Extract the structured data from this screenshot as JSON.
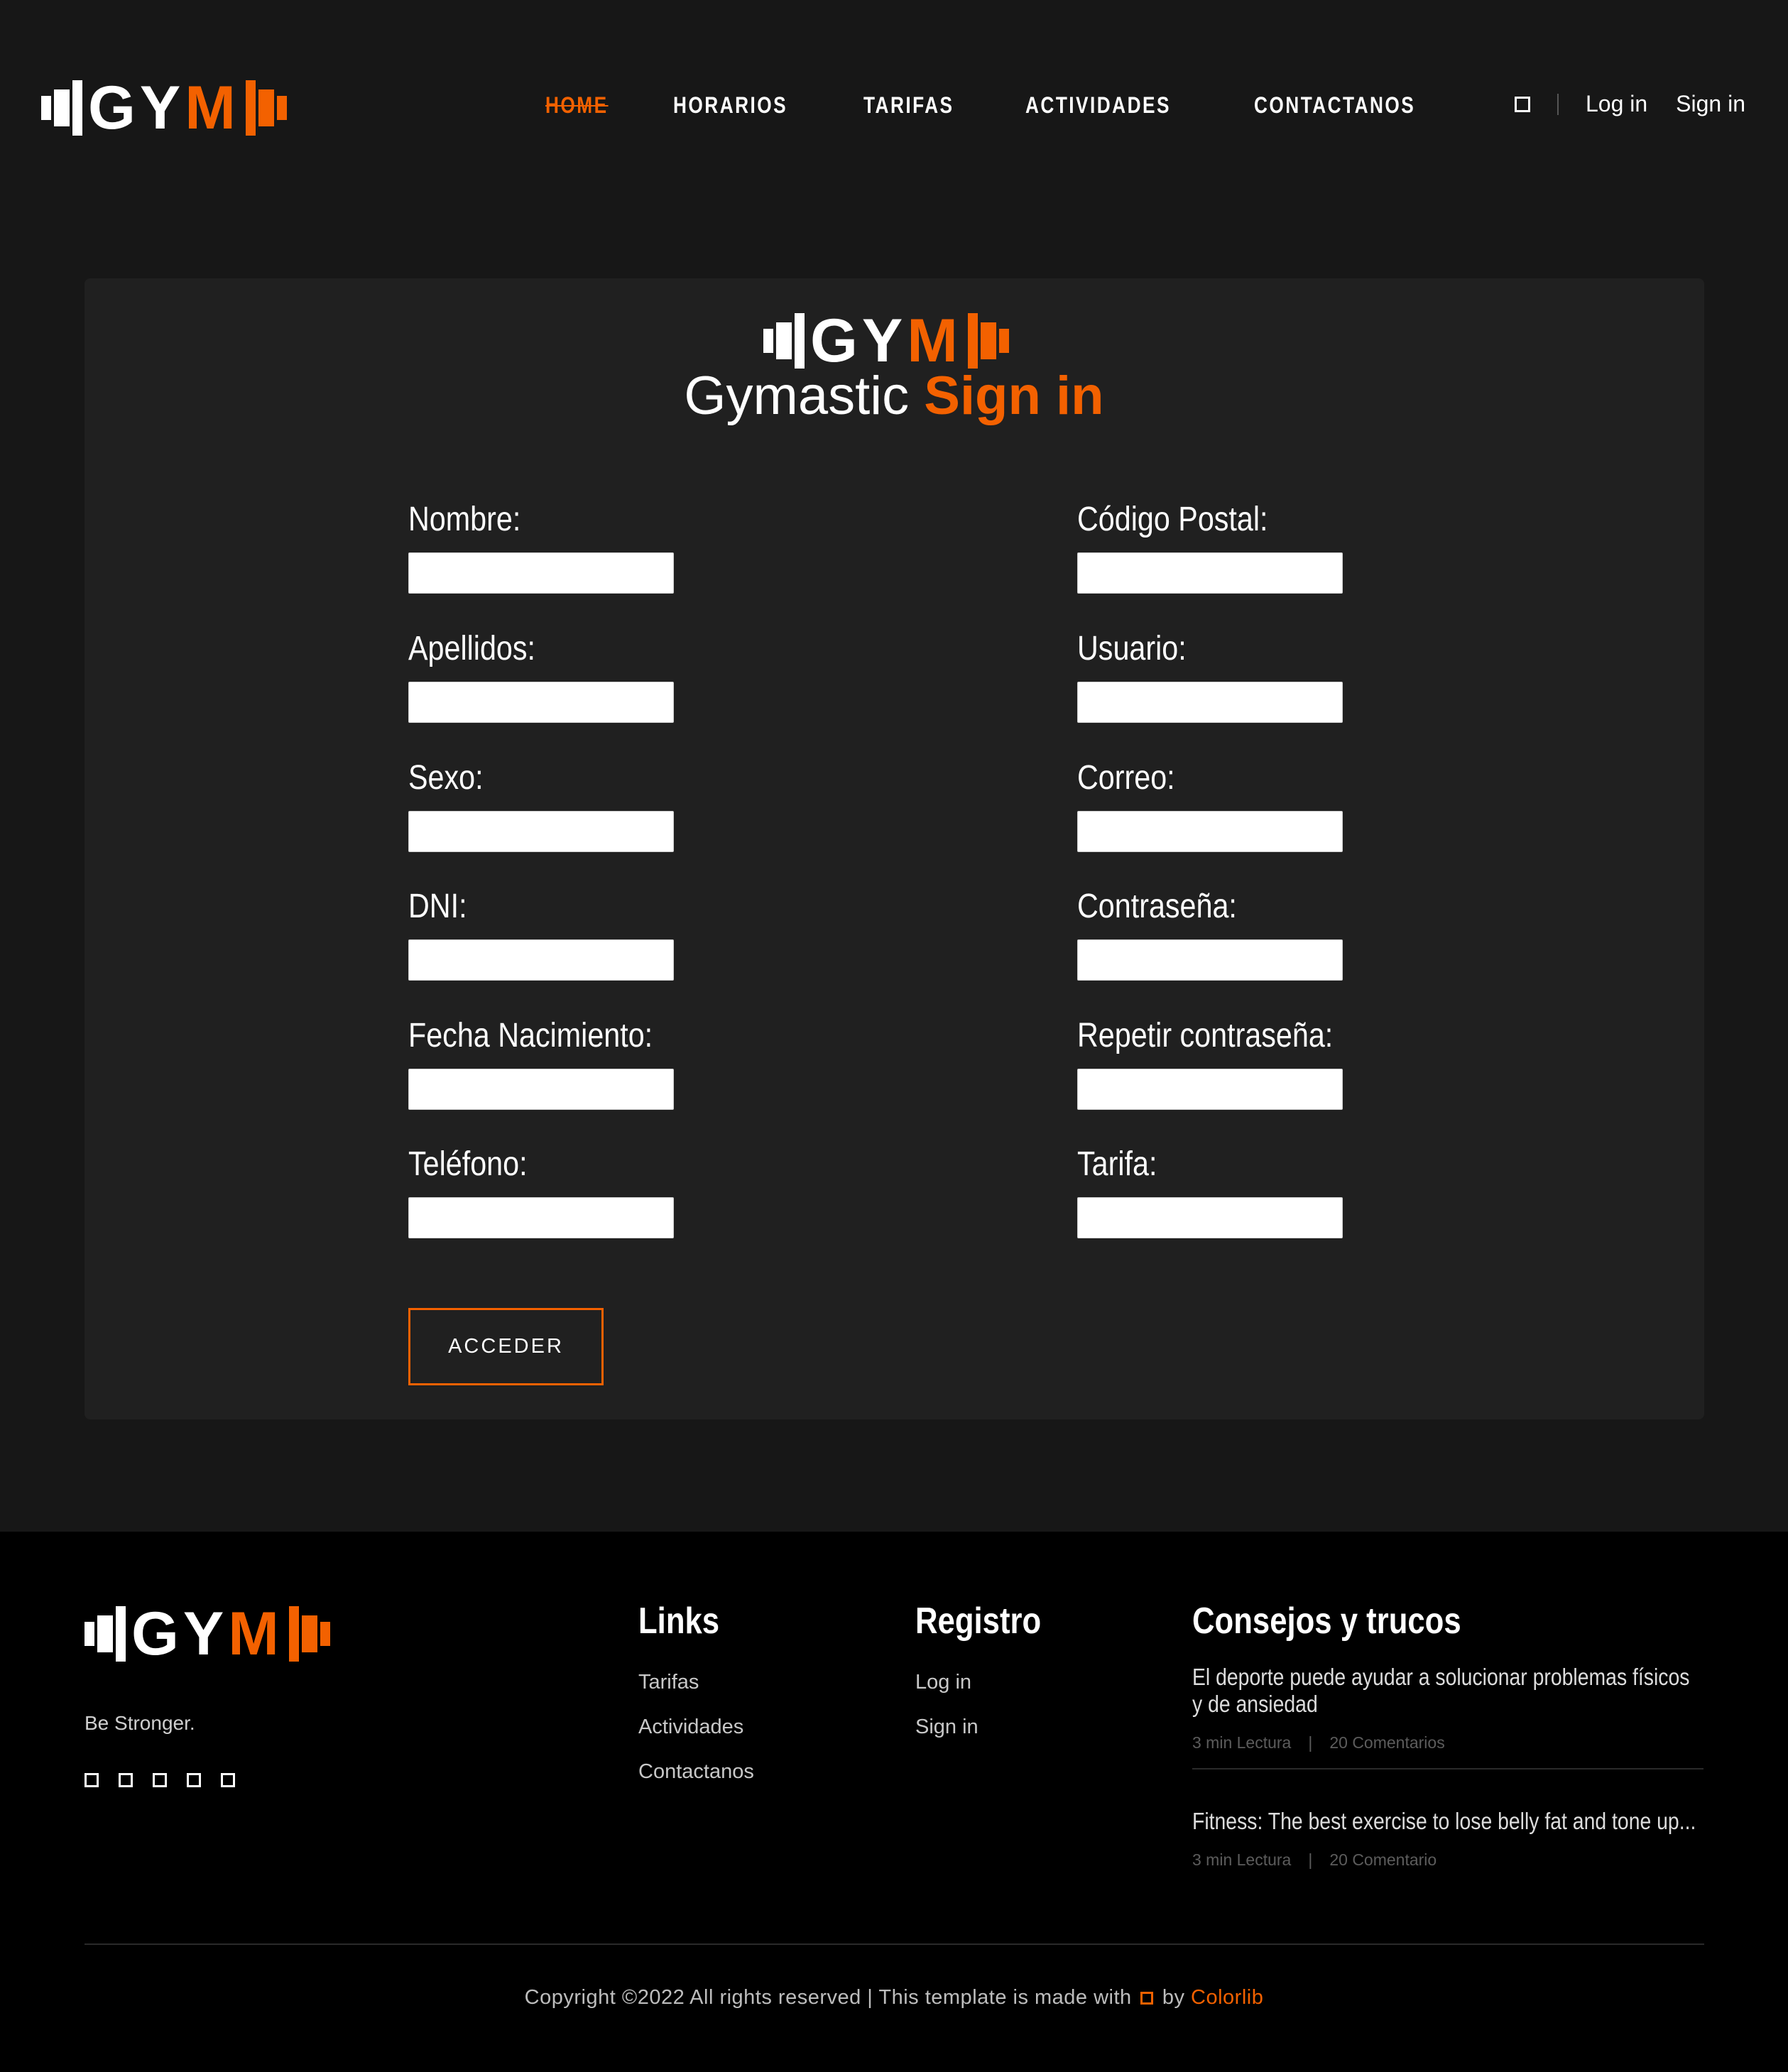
{
  "brand": {
    "logo_left": "GY",
    "logo_right": "M",
    "accent_color": "#f36100"
  },
  "nav": {
    "items": [
      {
        "label": "HOME",
        "active": true
      },
      {
        "label": "HORARIOS",
        "active": false
      },
      {
        "label": "TARIFAS",
        "active": false
      },
      {
        "label": "ACTIVIDADES",
        "active": false
      },
      {
        "label": "CONTACTANOS",
        "active": false
      }
    ],
    "search_icon": "square-icon",
    "login_label": "Log in",
    "signin_label": "Sign in"
  },
  "form": {
    "title_plain": "Gymastic",
    "title_highlight": "Sign in",
    "left_fields": [
      {
        "label": "Nombre:",
        "value": ""
      },
      {
        "label": "Apellidos:",
        "value": ""
      },
      {
        "label": "Sexo:",
        "value": ""
      },
      {
        "label": "DNI:",
        "value": ""
      },
      {
        "label": "Fecha Nacimiento:",
        "value": ""
      },
      {
        "label": "Teléfono:",
        "value": ""
      }
    ],
    "right_fields": [
      {
        "label": "Código Postal:",
        "value": ""
      },
      {
        "label": "Usuario:",
        "value": ""
      },
      {
        "label": "Correo:",
        "value": ""
      },
      {
        "label": "Contraseña:",
        "value": ""
      },
      {
        "label": "Repetir contraseña:",
        "value": ""
      },
      {
        "label": "Tarifa:",
        "value": ""
      }
    ],
    "submit_label": "ACCEDER"
  },
  "footer": {
    "tagline": "Be Stronger.",
    "social_icons": [
      "square-icon",
      "square-icon",
      "square-icon",
      "square-icon",
      "square-icon"
    ],
    "links_title": "Links",
    "links": [
      "Tarifas",
      "Actividades",
      "Contactanos"
    ],
    "registro_title": "Registro",
    "registro_links": [
      "Log in",
      "Sign in"
    ],
    "tips_title": "Consejos y trucos",
    "tips": [
      {
        "title": "El deporte puede ayudar a solucionar problemas físicos y de ansiedad",
        "read": "3 min Lectura",
        "comments": "20 Comentarios"
      },
      {
        "title": "Fitness: The best exercise to lose belly fat and tone up...",
        "read": "3 min Lectura",
        "comments": "20 Comentario"
      }
    ],
    "copyright_prefix": "Copyright ©2022 All rights reserved | This template is made with",
    "copyright_by": "by",
    "copyright_brand": "Colorlib"
  }
}
